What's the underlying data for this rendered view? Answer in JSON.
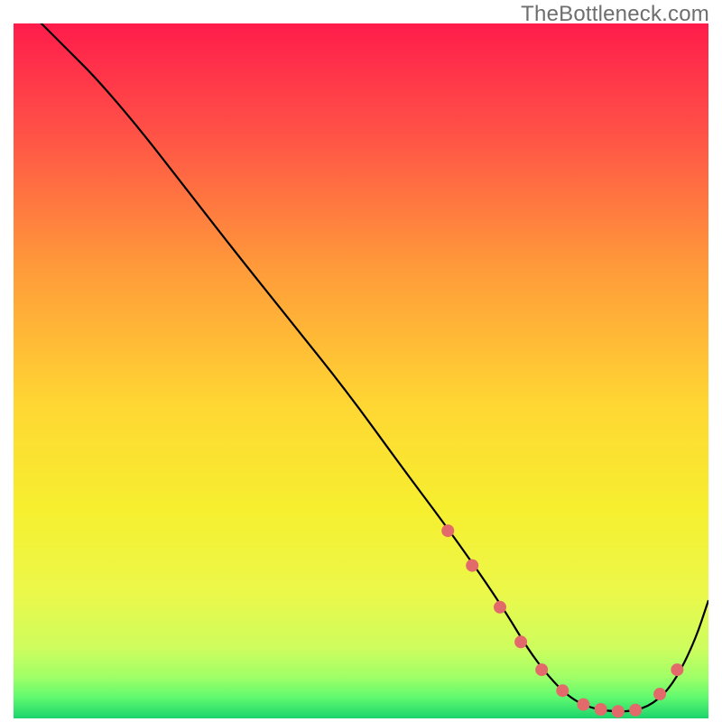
{
  "watermark": "TheBottleneck.com",
  "chart_data": {
    "type": "line",
    "title": "",
    "xlabel": "",
    "ylabel": "",
    "xlim": [
      0,
      100
    ],
    "ylim": [
      0,
      100
    ],
    "grid": false,
    "legend": false,
    "background_gradient": {
      "stops": [
        {
          "offset": 0.0,
          "color": "#ff1c4b"
        },
        {
          "offset": 0.15,
          "color": "#ff4f47"
        },
        {
          "offset": 0.35,
          "color": "#ff9a3a"
        },
        {
          "offset": 0.55,
          "color": "#ffd733"
        },
        {
          "offset": 0.7,
          "color": "#f6ef2f"
        },
        {
          "offset": 0.82,
          "color": "#ebf84a"
        },
        {
          "offset": 0.9,
          "color": "#cdfd5e"
        },
        {
          "offset": 0.94,
          "color": "#a0ff67"
        },
        {
          "offset": 0.97,
          "color": "#60f96f"
        },
        {
          "offset": 1.0,
          "color": "#1bd46c"
        }
      ]
    },
    "series": [
      {
        "name": "curve",
        "color": "#000000",
        "width": 2.2,
        "x": [
          0,
          4,
          8,
          12,
          18,
          25,
          32,
          40,
          48,
          56,
          62,
          67,
          71,
          74,
          77,
          80,
          83,
          86,
          89,
          92,
          95,
          98,
          100
        ],
        "y": [
          104,
          100,
          96,
          92,
          85,
          76,
          67,
          57,
          47,
          36,
          28,
          21,
          15,
          10,
          6,
          3,
          1.5,
          1,
          1,
          2,
          5,
          11,
          17
        ]
      }
    ],
    "markers": {
      "color": "#e36a6a",
      "radius": 7,
      "x": [
        62.5,
        66,
        70,
        73,
        76,
        79,
        82,
        84.5,
        87,
        89.5,
        93,
        95.5
      ],
      "y": [
        27,
        22,
        16,
        11,
        7,
        4,
        2,
        1.3,
        1,
        1.2,
        3.5,
        7
      ]
    }
  }
}
